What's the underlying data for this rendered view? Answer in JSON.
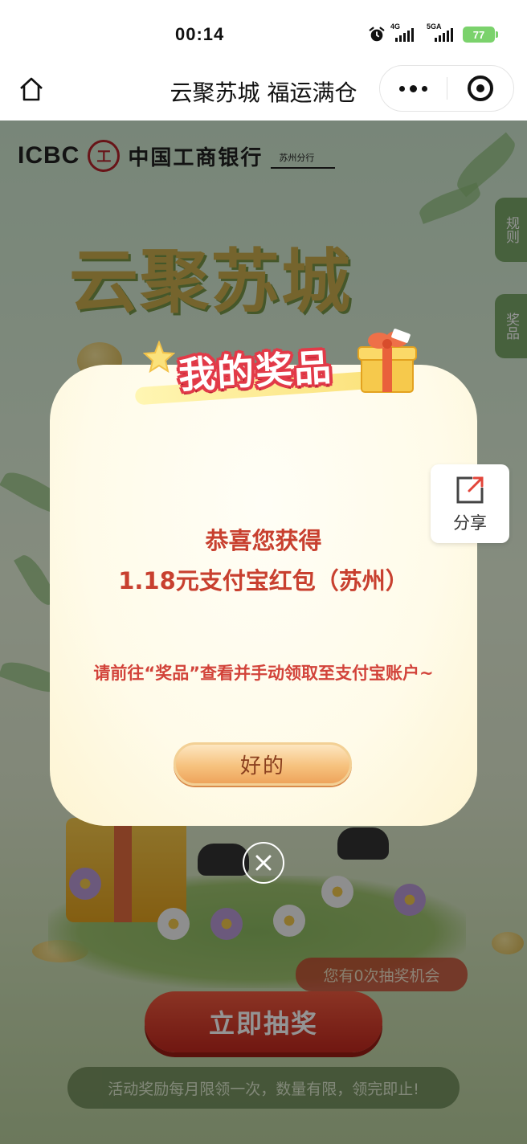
{
  "status_bar": {
    "time": "00:14",
    "network_1": "4G",
    "network_2": "5GA",
    "battery": "77"
  },
  "nav": {
    "title": "云聚苏城 福运满仓"
  },
  "page": {
    "bank_latin": "ICBC",
    "bank_mark": "工",
    "bank_name": "中国工商银行",
    "branch": "苏州分行",
    "hero_title": "云聚苏城",
    "side_rules": "规则",
    "side_prizes": "奖品",
    "share_label": "分享",
    "chance_text": "您有0次抽奖机会",
    "draw_button": "立即抽奖",
    "notice": "活动奖励每月限领一次，数量有限，领完即止!"
  },
  "modal": {
    "header_title": "我的奖品",
    "congrats": "恭喜您获得",
    "prize": "1.18元支付宝红包（苏州）",
    "instruction": "请前往“奖品”查看并手动领取至支付宝账户~",
    "ok_button": "好的"
  },
  "colors": {
    "accent_red": "#c8402f",
    "side_tab_green": "#7aa869",
    "battery_green": "#7bd26c"
  }
}
